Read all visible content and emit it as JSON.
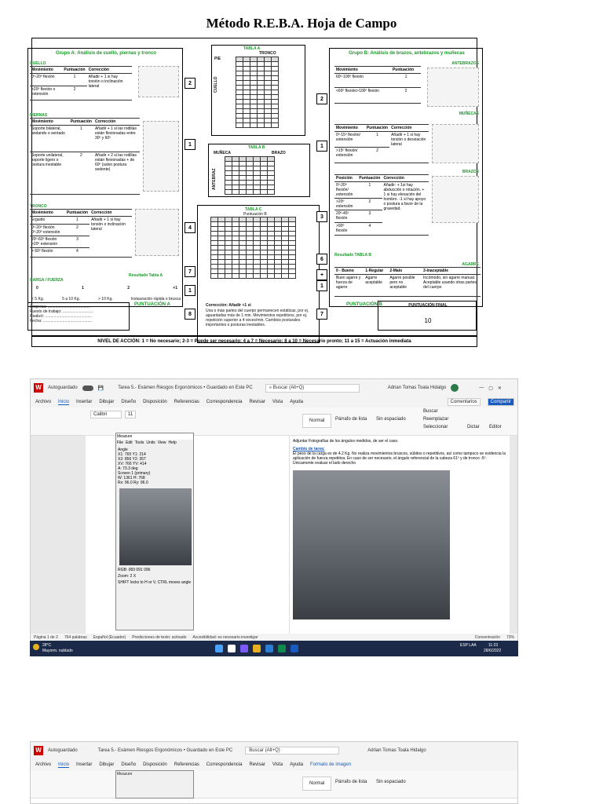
{
  "title": "Método R.E.B.A.   Hoja de Campo",
  "grupoA": {
    "header": "Grupo A: Análisis de cuello, piernas y tronco",
    "cuello": {
      "label": "CUELLO",
      "cols": [
        "Movimiento",
        "Puntuación",
        "Corrección"
      ],
      "rows": [
        [
          "0º-20º flexión",
          "1"
        ],
        [
          ">20º flexión o extensión",
          "2"
        ]
      ],
      "corr": "Añadir + 1 si hay torsión o inclinación lateral"
    },
    "piernas": {
      "label": "PIERNAS",
      "cols": [
        "Movimiento",
        "Puntuación",
        "Corrección"
      ],
      "rows": [
        [
          "Soporte bilateral, andando o sentado",
          "1"
        ],
        [
          "Soporte unilateral, soporte ligero o postura inestable",
          "2"
        ]
      ],
      "corr1": "Añadir + 1 si las rodillas están flexionadas entre 30º y 60º",
      "corr2": "Añadir + 2 si las rodillas están flexionadas + de 60º (salvo postura sedente)"
    },
    "tronco": {
      "label": "TRONCO",
      "cols": [
        "Movimiento",
        "Puntuación",
        "Corrección"
      ],
      "rows": [
        [
          "Erguido",
          "1"
        ],
        [
          "0º-20º flexión 0º-20º extensión",
          "2"
        ],
        [
          "20º-60º flexión >20º extensión",
          "3"
        ],
        [
          "> 60º  flexión",
          "4"
        ]
      ],
      "corr": "Añadir + 1 si hay torsión o inclinación lateral"
    },
    "resultado": "Resultado Tabla A",
    "carga": {
      "label": "CARGA / FUERZA",
      "vals": [
        "0",
        "1",
        "2",
        "+1"
      ],
      "desc": [
        "< 5 Kg.",
        "5 a 10 Kg.",
        "> 10 Kg.",
        "Instauración rápida o brusca"
      ]
    },
    "puntuacion": "PUNTUACIÓN  A"
  },
  "tablaA": {
    "title": "TABLA  A",
    "tronco": "TRONCO",
    "pie": "PIE",
    "cuello": "CUELLO"
  },
  "tablaB": {
    "title": "TABLA  B",
    "muneca": "MUÑECA",
    "brazo": "BRAZO",
    "antebrazo": "ANTEBRAZ"
  },
  "tablaC": {
    "title": "TABLA  C",
    "punt": "Puntuación B",
    "actividad": "Corrección: Añadir +1 si",
    "act_text": "Una o más partes del cuerpo permanecen estáticas, por ej. aguantadas  más de 1 min. Movimientos repetitivos, por ej. repetición superior a 4 veces/min. Cambios posturales importantes o posturas inestables."
  },
  "grupoB": {
    "header": "Grupo B: Análisis de brazos, antebrazos y muñecas",
    "antebrazos": {
      "label": "ANTEBRAZOS",
      "cols": [
        "Movimiento",
        "Puntuación"
      ],
      "rows": [
        [
          "60º-100º flexión",
          "1"
        ],
        [
          "<60º flexión>100º flexión",
          "2"
        ]
      ]
    },
    "munecas": {
      "label": "MUÑECAS",
      "cols": [
        "Movimiento",
        "Puntuación",
        "Corrección"
      ],
      "rows": [
        [
          "0º-15º flexión/ extensión",
          "1"
        ],
        [
          ">15º flexión/ extensión",
          "2"
        ]
      ],
      "corr": "Añadir + 1 si hay torsión o desviación lateral"
    },
    "brazos": {
      "label": "BRAZOS",
      "cols": [
        "Posición",
        "Puntuación",
        "Corrección"
      ],
      "rows": [
        [
          "0º-20º flexión/ extensión",
          "1"
        ],
        [
          ">20º extensión",
          "2"
        ],
        [
          "20º-45º flexión",
          "3"
        ],
        [
          ">90º flexión",
          "4"
        ]
      ],
      "corr": "Añadir: + 1si hay abducción o rotación. + 1 si hay elevación del hombro. -1 si hay apoyo o postura a favor de la gravedad."
    },
    "resultado": "Resultado TABLA B",
    "agarre": {
      "label": "AGARRE",
      "cols": [
        "0 - Bueno",
        "1-Regular",
        "2-Malo",
        "3-Inaceptable"
      ],
      "vals": [
        "Buen agarre y fuerza de agarre",
        "Agarre aceptable",
        "Agarre posible pero no aceptable",
        "Incómodo, sin agarre manual. Aceptable usando otras partes del cuerpo"
      ]
    },
    "puntuacion": "PUNTUACIÓN  B",
    "final": "PUNTUACIÓN FINAL",
    "final_val": "10"
  },
  "scores": {
    "a_cuello": "2",
    "a_piernas": "1",
    "a_tronco": "4",
    "a_res": "7",
    "a_carga": "1",
    "a_total": "8",
    "b_ante": "2",
    "b_mun": "1",
    "b_brazo": "3",
    "b_res": "6",
    "b_agarre": "1",
    "b_total": "7",
    "c_plus": "+"
  },
  "empresa": [
    "Empresa: .......................................",
    "Puesto de trabajo: ............................",
    "Realizó: ...........................................",
    "Fecha: ............................................."
  ],
  "nivel": "NIVEL DE ACCIÓN: 1 = No necesario; 2-3 = Puede ser necesario; 4 a 7 = Necesario; 8 a 10 = Necesario pronto; 11 a 15 = Actuación inmediata",
  "word1": {
    "autosave": "Autoguardado",
    "doc_title": "Tarea 5.- Exámen Riesgos Ergonómicos • Guardado en Este PC",
    "search": "Buscar (Alt+Q)",
    "user": "Adrian Tomas Toala Hidalgo",
    "menu": [
      "Archivo",
      "Inicio",
      "Insertar",
      "Dibujar",
      "Diseño",
      "Disposición",
      "Referencias",
      "Correspondencia",
      "Revisar",
      "Vista",
      "Ayuda"
    ],
    "comments": "Comentarios",
    "share": "Compartir",
    "font": "Calibri",
    "size": "11",
    "styles": [
      "Normal",
      "Párrafo de lista",
      "Sin espaciado"
    ],
    "buscar": "Buscar",
    "reemplazar": "Reemplazar",
    "seleccionar": "Seleccionar",
    "dictar": "Dictar",
    "editor": "Editor",
    "body1": "Adjuntar Fotografías de los ángulos medidos, de ser el caso.",
    "cambio": "Cambio de tarea:",
    "body2": "El peso de la carga es de 4.2 Kg. No realiza movimientos bruscos, súbitos o repetitivos, así como tampoco se evidencia la aplicación de fuerza repetitiva. En caso de ser necesario, el ángulo referencial de la cabeza 61º y de tronco -5º. Únicamente evaluar el lado derecho",
    "status": [
      "Página 1 de 2",
      "764 palabras",
      "Español (Ecuador)",
      "Predicciones de texto: activado",
      "Accesibilidad: es necesario investigar",
      "Concentración",
      "73%"
    ]
  },
  "meazure": {
    "title": "Meazure",
    "menu": [
      "File",
      "Edit",
      "Tools",
      "Units",
      "View",
      "Help"
    ],
    "angle": "Angle",
    "x1": "765",
    "y1": "214",
    "x2": "856",
    "y2": "357",
    "xv": "766",
    "yv": "414",
    "a": "73.3",
    "deg": "deg",
    "screen": "Screen 1 (primary)",
    "w": "1361",
    "h": "768",
    "rx": "96.0",
    "ry": "96.0",
    "rgb": "RGB: 083 091 096",
    "zoom": "2 X",
    "hint": "SHIFT locks to H or V, CTRL moves angle"
  },
  "taskbar": {
    "temp": "28°C",
    "weather": "Mayorm. nublado",
    "lang": "ESP LAA",
    "time": "11:23",
    "date": "28/6/2022"
  },
  "word2": {
    "menu_extra": "Formato de imagen"
  }
}
